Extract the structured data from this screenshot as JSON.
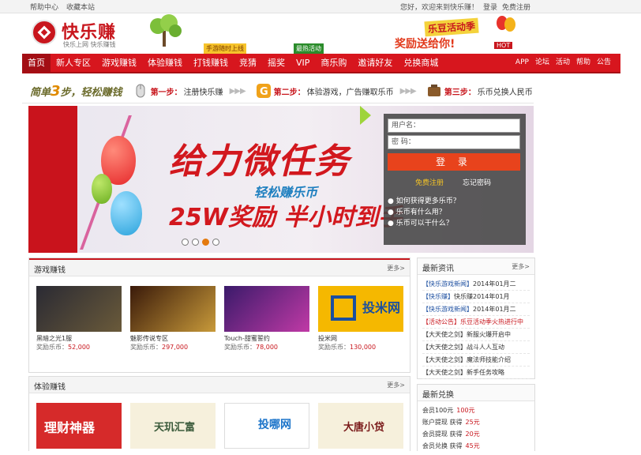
{
  "topbar": {
    "left": [
      "帮助中心",
      "收藏本站"
    ],
    "right": [
      "您好，欢迎来到快乐赚！",
      "登录",
      "免费注册"
    ]
  },
  "header": {
    "logo_text": "快乐赚",
    "logo_sub": "快乐上网 快乐赚钱",
    "badge1": "手游随时上线",
    "badge2": "最热活动",
    "promo_title": "乐豆活动季",
    "promo_text": "奖励送给你!",
    "promo_tag": "HOT"
  },
  "nav": {
    "items": [
      "首页",
      "新人专区",
      "游戏赚钱",
      "体验赚钱",
      "打钱赚钱",
      "竞猜",
      "摇奖",
      "VIP",
      "商乐购",
      "邀请好友",
      "兑换商城"
    ],
    "right": [
      "APP",
      "论坛",
      "活动",
      "帮助",
      "公告"
    ]
  },
  "steps": {
    "lead_pre": "简单",
    "lead_num": "3",
    "lead_post": "步，轻松赚钱",
    "items": [
      {
        "num": "第一步：",
        "text": "注册快乐赚"
      },
      {
        "num": "第二步：",
        "text": "体验游戏，广告赚取乐币"
      },
      {
        "num": "第三步：",
        "text": "乐币兑换人民币"
      }
    ]
  },
  "banner": {
    "title": "给力微任务",
    "sub": "轻松赚乐币",
    "big": "25W奖励 半小时到手"
  },
  "login": {
    "user_placeholder": "用户名：",
    "pass_placeholder": "密 码：",
    "button": "登 录",
    "register": "免费注册",
    "forgot": "忘记密码",
    "faq": [
      "如何获得更多乐币？",
      "乐币有什么用？",
      "乐币可以干什么？"
    ]
  },
  "game_panel": {
    "title": "游戏赚钱",
    "more": "更多>",
    "games": [
      {
        "name": "黑暗之光1服",
        "reward_label": "奖励乐币：",
        "reward": "52,000",
        "color": "#3a3a46"
      },
      {
        "name": "魅影传说专区",
        "reward_label": "奖励乐币：",
        "reward": "297,000",
        "color": "#5c2a14"
      },
      {
        "name": "Touch-甜蜜誓约",
        "reward_label": "奖励乐币：",
        "reward": "78,000",
        "color": "#5a2a8c"
      },
      {
        "name": "投米网",
        "reward_label": "奖励乐币：",
        "reward": "130,000",
        "color": "#f5b800"
      }
    ]
  },
  "exp_panel": {
    "title": "体验赚钱",
    "more": "更多>",
    "tiles": [
      {
        "label": "理财神器",
        "color": "#d62a2a",
        "text_color": "#ffffff"
      },
      {
        "label": "天玑汇富",
        "color": "#f6f0dc",
        "text_color": "#3a5a3a"
      },
      {
        "label": "投哪网",
        "color": "#ffffff",
        "text_color": "#1a73c9"
      },
      {
        "label": "大唐小贷",
        "color": "#f6f0dc",
        "text_color": "#7a1a1a"
      }
    ]
  },
  "news": {
    "title": "最新资讯",
    "more": "更多>",
    "items": [
      {
        "tag": "【快乐游戏新闻】",
        "text": "2014年01月二",
        "tag_color": "blue"
      },
      {
        "tag": "【快乐赚】",
        "text": "快乐赚2014年01月",
        "tag_color": "blue"
      },
      {
        "tag": "【快乐游戏新闻】",
        "text": "2014年01月二",
        "tag_color": "blue"
      },
      {
        "tag": "【活动公告】",
        "text": "乐豆活动季火热进行中",
        "tag_color": "red"
      },
      {
        "tag": "【大天使之剑】",
        "text": "新服火爆开启中",
        "tag_color": "blue"
      },
      {
        "tag": "【大天使之剑】",
        "text": "战斗人人互动",
        "tag_color": "blue"
      },
      {
        "tag": "【大天使之剑】",
        "text": "魔法师技能介绍",
        "tag_color": "blue"
      },
      {
        "tag": "【大天使之剑】",
        "text": "新手任务攻略",
        "tag_color": "blue"
      }
    ]
  },
  "exchange": {
    "title": "最新兑换",
    "items": [
      {
        "text": "会员100元",
        "value": "100元"
      },
      {
        "text": "账户提现 获得",
        "value": "25元"
      },
      {
        "text": "会员提现 获得",
        "value": "20元"
      },
      {
        "text": "会员兑换 获得",
        "value": "45元"
      }
    ]
  }
}
